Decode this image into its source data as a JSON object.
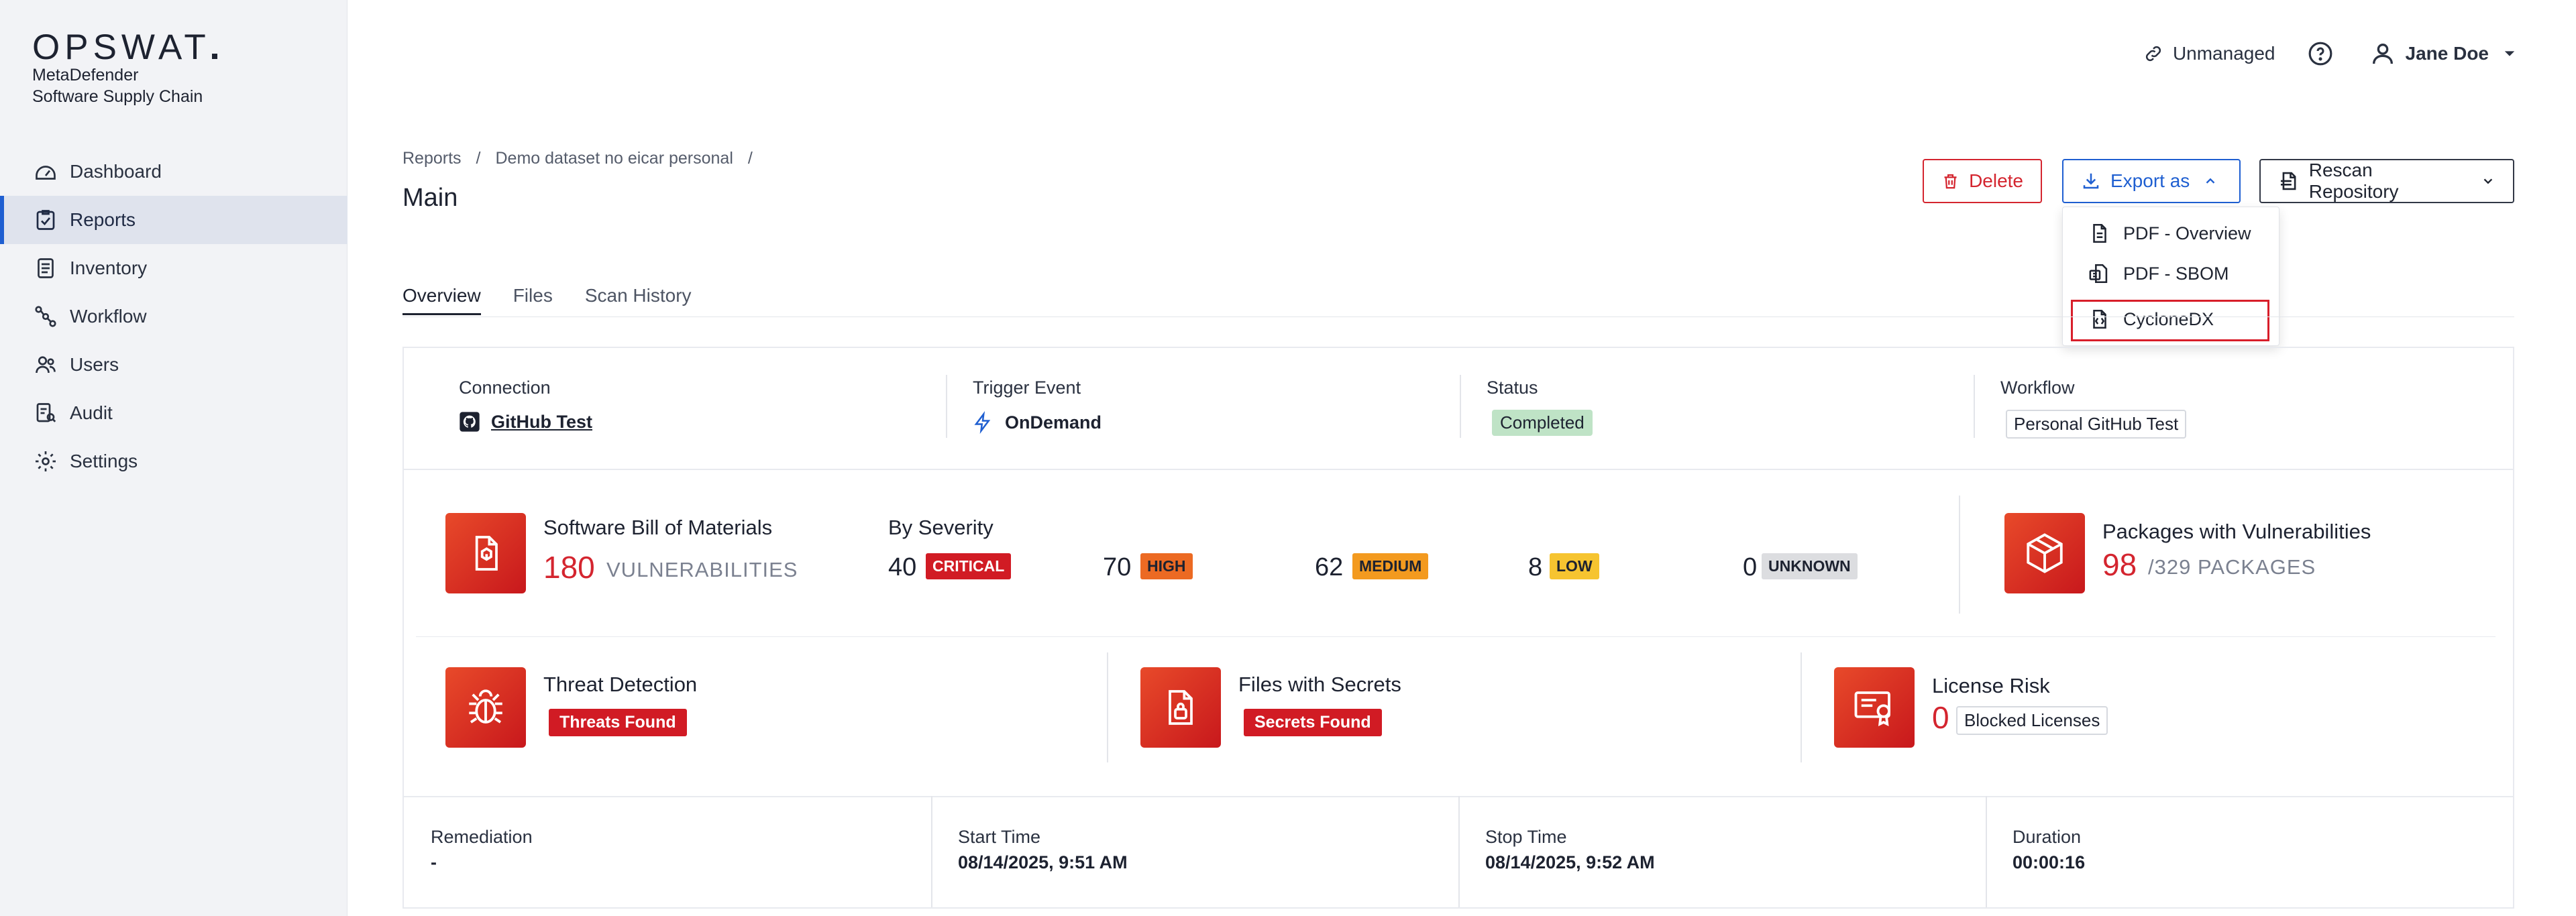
{
  "app": {
    "logo": "OPSWAT",
    "product_line1": "MetaDefender",
    "product_line2": "Software Supply Chain"
  },
  "sidebar": {
    "items": [
      {
        "label": "Dashboard",
        "icon": "dashboard-icon"
      },
      {
        "label": "Reports",
        "icon": "reports-icon",
        "active": true
      },
      {
        "label": "Inventory",
        "icon": "inventory-icon"
      },
      {
        "label": "Workflow",
        "icon": "workflow-icon"
      },
      {
        "label": "Users",
        "icon": "users-icon"
      },
      {
        "label": "Audit",
        "icon": "audit-icon"
      },
      {
        "label": "Settings",
        "icon": "gear-icon"
      }
    ]
  },
  "header": {
    "unmanaged_label": "Unmanaged",
    "user_name": "Jane Doe"
  },
  "breadcrumb": [
    "Reports",
    "Demo dataset no eicar personal"
  ],
  "breadcrumb_sep": "/",
  "page_title": "Main",
  "actions": {
    "delete_label": "Delete",
    "export_label": "Export as",
    "rescan_label": "Rescan Repository"
  },
  "export_menu": {
    "items": [
      "PDF - Overview",
      "PDF - SBOM",
      "CycloneDX"
    ],
    "highlighted": "CycloneDX"
  },
  "tabs": [
    "Overview",
    "Files",
    "Scan History"
  ],
  "info": {
    "connection_label": "Connection",
    "connection_value": "GitHub Test",
    "trigger_label": "Trigger Event",
    "trigger_value": "OnDemand",
    "status_label": "Status",
    "status_value": "Completed",
    "workflow_label": "Workflow",
    "workflow_value": "Personal GitHub Test"
  },
  "sbom": {
    "title": "Software Bill of Materials",
    "count": "180",
    "unit": "VULNERABILITIES"
  },
  "severity": {
    "title": "By Severity",
    "items": [
      {
        "count": "40",
        "label": "CRITICAL",
        "bg": "#d11b24",
        "fg": "#ffffff"
      },
      {
        "count": "70",
        "label": "HIGH",
        "bg": "#ec6a23",
        "fg": "#1d2230"
      },
      {
        "count": "62",
        "label": "MEDIUM",
        "bg": "#f39a1f",
        "fg": "#1d2230"
      },
      {
        "count": "8",
        "label": "LOW",
        "bg": "#f6c430",
        "fg": "#1d2230"
      },
      {
        "count": "0",
        "label": "UNKNOWN",
        "bg": "#dcdde0",
        "fg": "#1d2230"
      }
    ]
  },
  "packages": {
    "title": "Packages with Vulnerabilities",
    "count": "98",
    "total": "/329 PACKAGES"
  },
  "threat": {
    "title": "Threat Detection",
    "badge": "Threats Found"
  },
  "secrets": {
    "title": "Files with Secrets",
    "badge": "Secrets Found"
  },
  "license": {
    "title": "License Risk",
    "count": "0",
    "badge": "Blocked Licenses"
  },
  "footer": {
    "remediation_label": "Remediation",
    "remediation_value": "-",
    "start_label": "Start Time",
    "start_value": "08/14/2025, 9:51 AM",
    "stop_label": "Stop Time",
    "stop_value": "08/14/2025, 9:52 AM",
    "duration_label": "Duration",
    "duration_value": "00:00:16"
  },
  "colors": {
    "accent": "#1f5fd1",
    "danger": "#d4252f",
    "tile_gradient_start": "#e84a2a",
    "tile_gradient_end": "#c8181c",
    "status_success_bg": "#bfe3c6"
  }
}
